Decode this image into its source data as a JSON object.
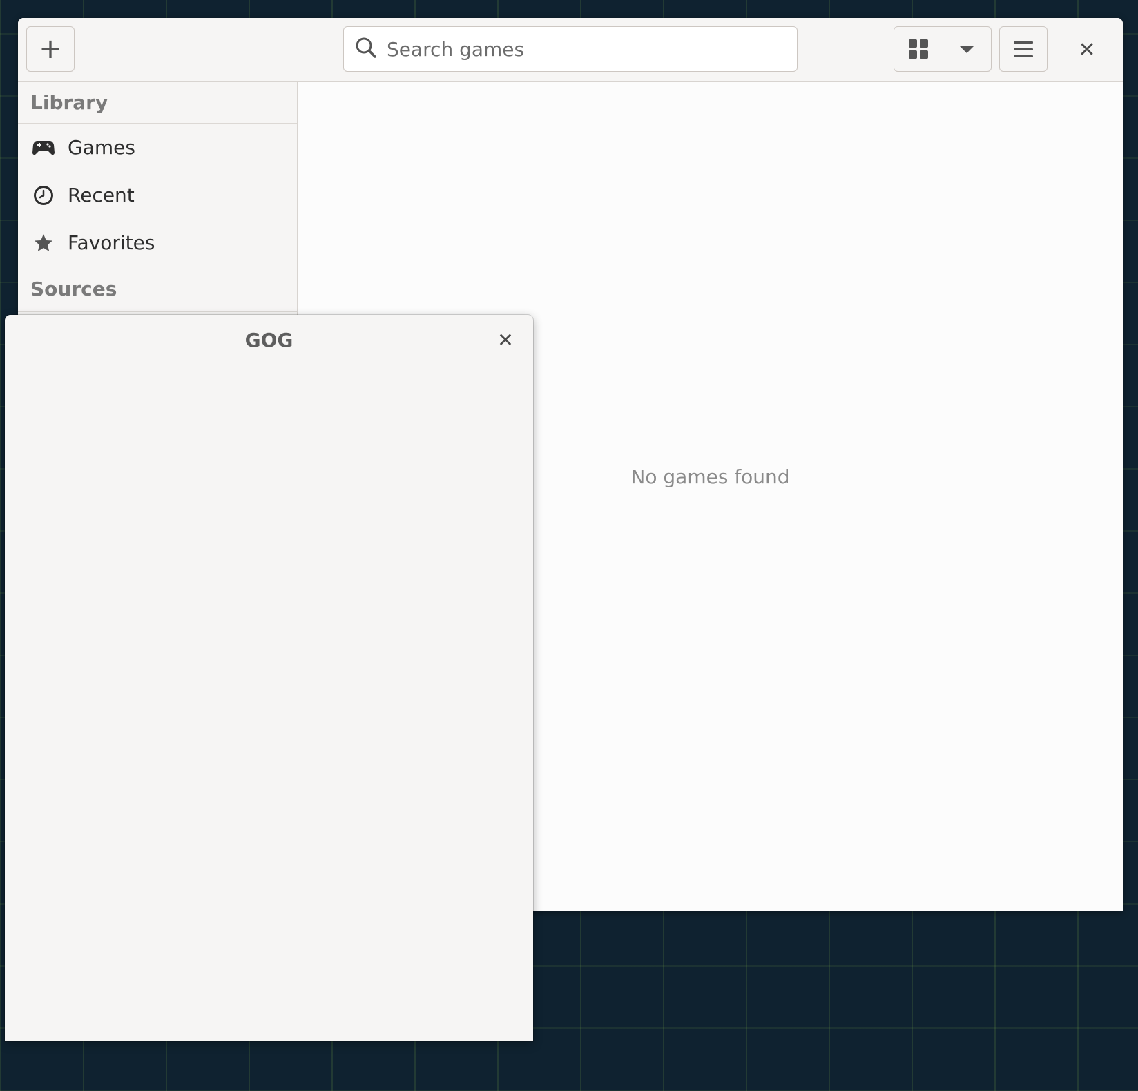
{
  "headerbar": {
    "search_placeholder": "Search games"
  },
  "sidebar": {
    "library_heading": "Library",
    "items": [
      {
        "label": "Games",
        "icon": "gamepad-icon"
      },
      {
        "label": "Recent",
        "icon": "clock-icon"
      },
      {
        "label": "Favorites",
        "icon": "star-icon"
      }
    ],
    "sources_heading": "Sources"
  },
  "content": {
    "empty_message": "No games found"
  },
  "dialog": {
    "title": "GOG"
  },
  "colors": {
    "desktop_background": "#0f2230",
    "window_background": "#fcfcfc",
    "headerbar_background": "#f6f5f4"
  }
}
